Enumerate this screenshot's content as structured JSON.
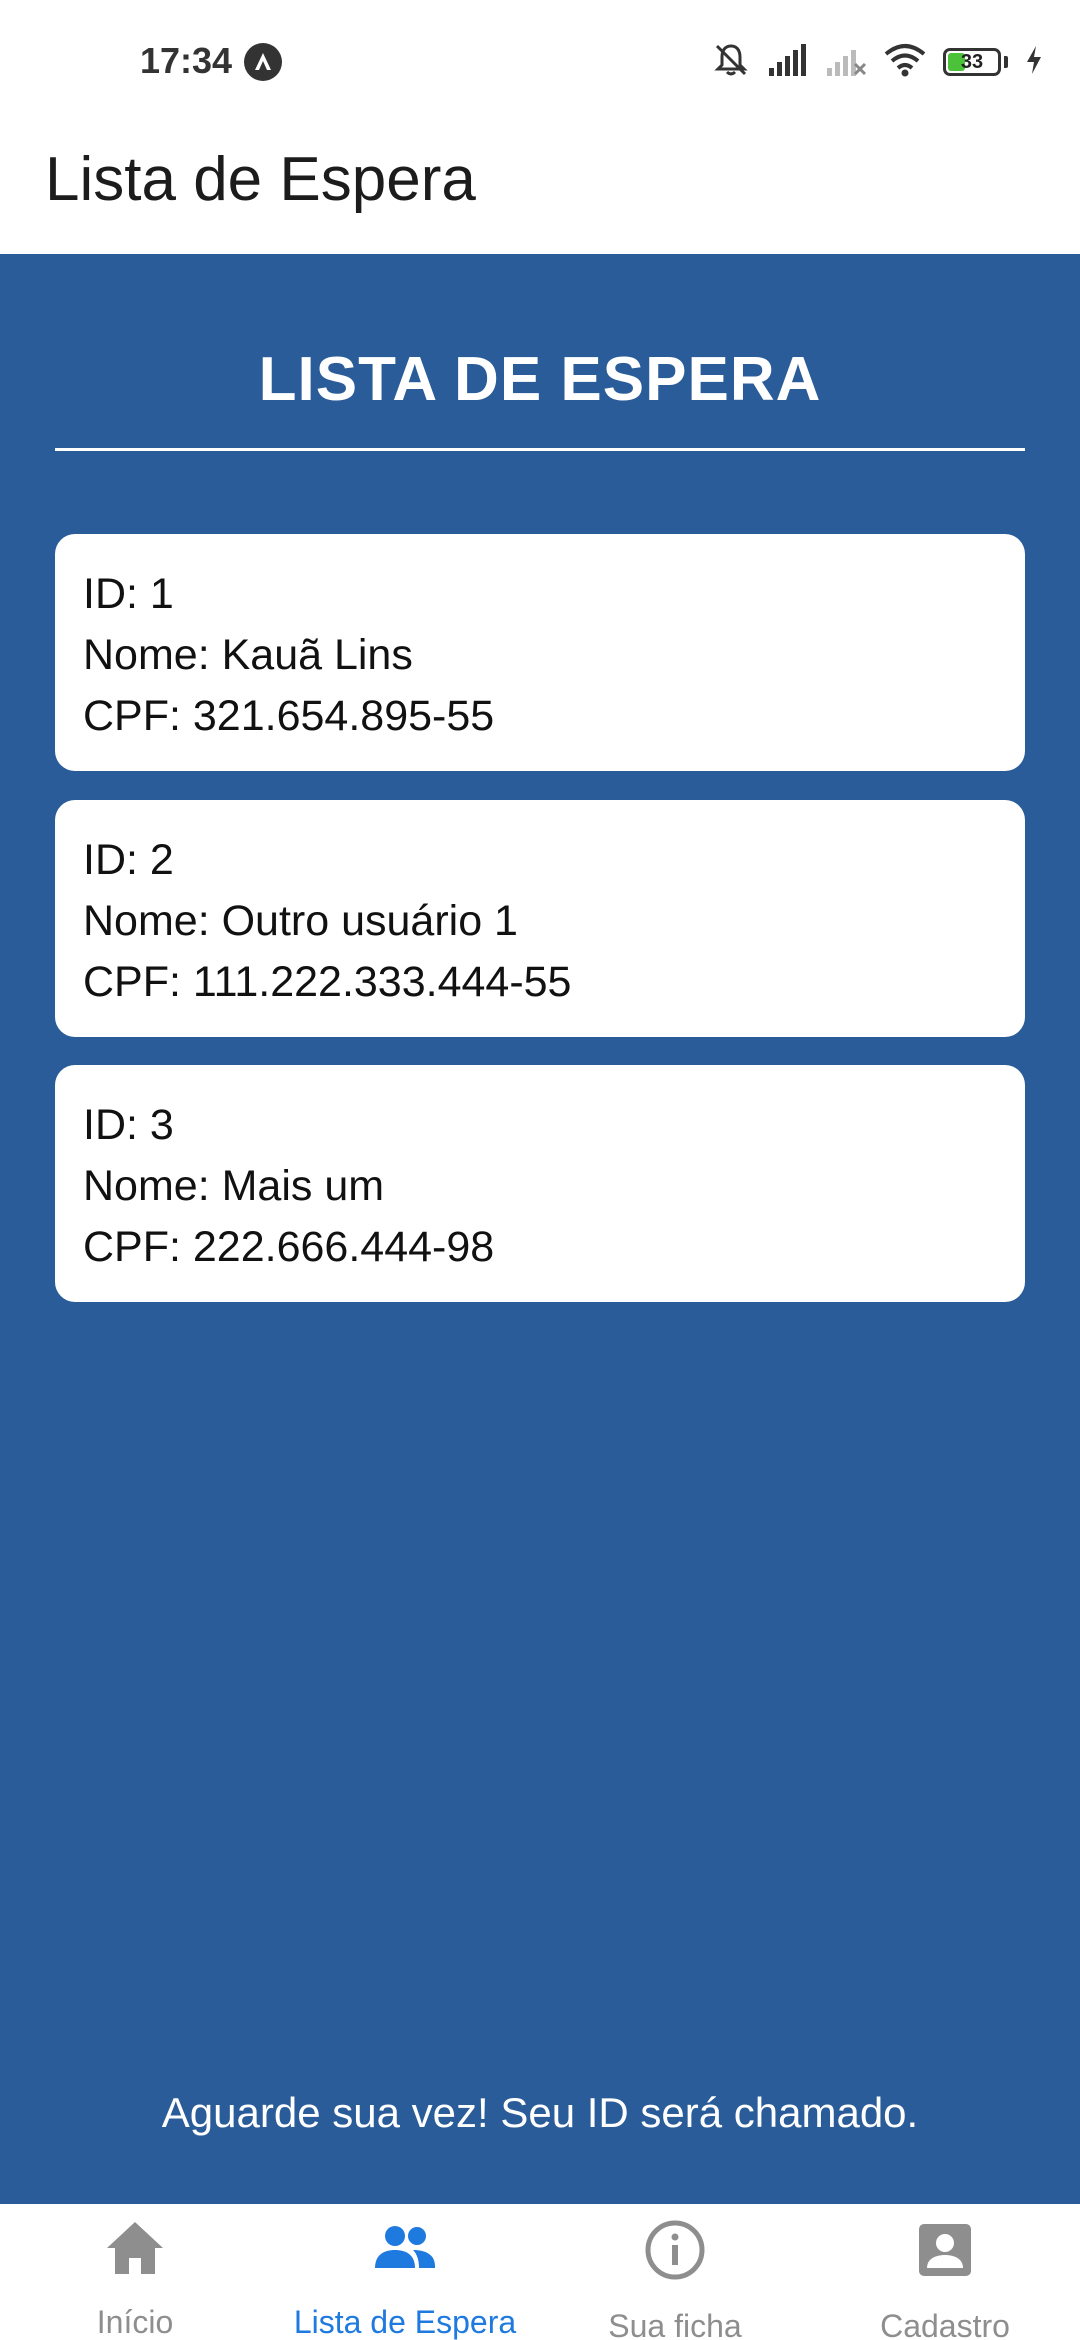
{
  "status_bar": {
    "time": "17:34",
    "battery_level": "33",
    "icons": [
      "app-notification-icon",
      "mute-icon",
      "signal-icon",
      "signal-off-icon",
      "wifi-icon",
      "battery-icon",
      "charging-icon"
    ]
  },
  "header": {
    "title": "Lista de Espera"
  },
  "main": {
    "title": "LISTA DE ESPERA",
    "background_color": "#2a5c99",
    "entries": [
      {
        "id_text": "ID: 1",
        "name_text": "Nome: Kauã Lins",
        "cpf_text": "CPF: 321.654.895-55"
      },
      {
        "id_text": "ID: 2",
        "name_text": "Nome: Outro usuário 1",
        "cpf_text": "CPF: 111.222.333.444-55"
      },
      {
        "id_text": "ID: 3",
        "name_text": "Nome: Mais um",
        "cpf_text": "CPF: 222.666.444-98"
      }
    ],
    "footer_message": "Aguarde sua vez! Seu ID será chamado."
  },
  "tabs": [
    {
      "label": "Início",
      "icon": "home-icon",
      "active": false
    },
    {
      "label": "Lista de Espera",
      "icon": "people-icon",
      "active": true
    },
    {
      "label": "Sua ficha",
      "icon": "info-icon",
      "active": false
    },
    {
      "label": "Cadastro",
      "icon": "account-box-icon",
      "active": false
    }
  ],
  "colors": {
    "active_tab": "#1f7ae0",
    "inactive_tab": "#8e8e8e"
  }
}
